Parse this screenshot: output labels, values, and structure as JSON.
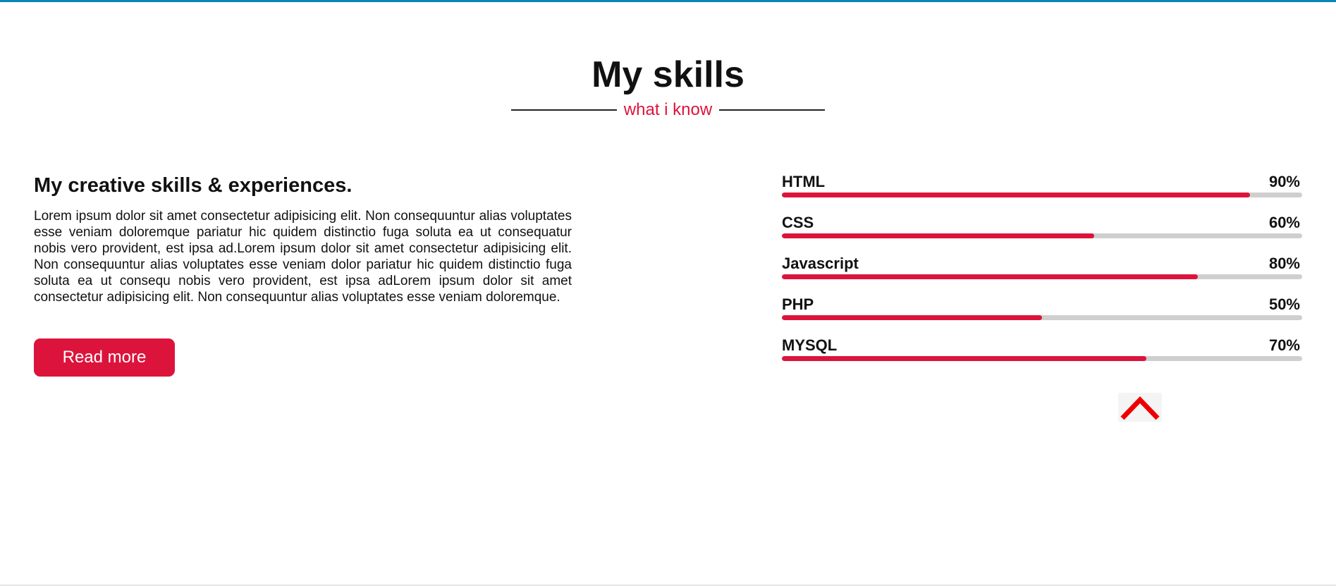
{
  "header": {
    "title": "My skills",
    "subtitle": "what i know"
  },
  "about": {
    "heading": "My creative skills & experiences.",
    "body": "Lorem ipsum dolor sit amet consectetur adipisicing elit. Non consequuntur alias voluptates esse veniam doloremque pariatur hic quidem distinctio fuga soluta ea ut consequatur nobis vero provident, est ipsa ad.Lorem ipsum dolor sit amet consectetur adipisicing elit. Non consequuntur alias voluptates esse veniam dolor pariatur hic quidem distinctio fuga soluta ea ut consequ nobis vero provident, est ipsa adLorem ipsum dolor sit amet consectetur adipisicing elit. Non consequuntur alias voluptates esse veniam doloremque.",
    "button_label": "Read more"
  },
  "skills": [
    {
      "name": "HTML",
      "percent_label": "90%",
      "level": 90
    },
    {
      "name": "CSS",
      "percent_label": "60%",
      "level": 60
    },
    {
      "name": "Javascript",
      "percent_label": "80%",
      "level": 80
    },
    {
      "name": "PHP",
      "percent_label": "50%",
      "level": 50
    },
    {
      "name": "MYSQL",
      "percent_label": "70%",
      "level": 70
    }
  ],
  "scroll_top": {
    "icon": "chevron-up-icon"
  },
  "colors": {
    "accent": "#dc143c",
    "top_border": "#0a86b0",
    "track": "#cfcfcf",
    "scroll_icon": "#ee0000"
  }
}
